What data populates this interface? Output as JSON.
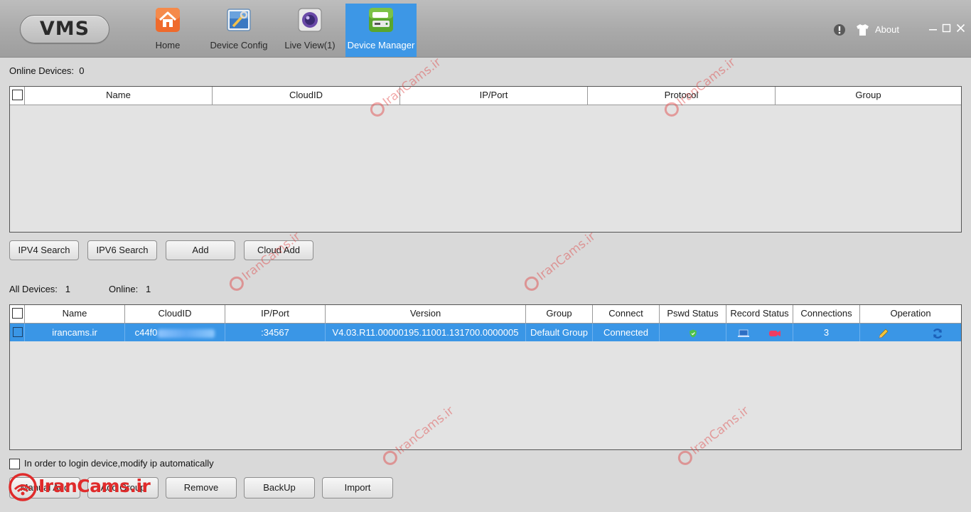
{
  "app": {
    "logo": "VMS"
  },
  "nav": {
    "tabs": [
      {
        "label": "Home",
        "icon": "home-icon"
      },
      {
        "label": "Device Config",
        "icon": "device-config-icon"
      },
      {
        "label": "Live View(1)",
        "icon": "live-view-icon"
      },
      {
        "label": "Device Manager",
        "icon": "device-manager-icon",
        "active": true
      }
    ],
    "about": "About"
  },
  "online_section": {
    "label": "Online Devices:",
    "count": "0",
    "columns": [
      "Name",
      "CloudID",
      "IP/Port",
      "Protocol",
      "Group"
    ]
  },
  "search_buttons": [
    "IPV4 Search",
    "IPV6 Search",
    "Add",
    "Cloud Add"
  ],
  "all_section": {
    "all_label": "All Devices:",
    "all_count": "1",
    "online_label": "Online:",
    "online_count": "1",
    "columns": [
      "Name",
      "CloudID",
      "IP/Port",
      "Version",
      "Group",
      "Connect",
      "Pswd Status",
      "Record Status",
      "Connections",
      "Operation"
    ],
    "rows": [
      {
        "name": "irancams.ir",
        "cloudid": "c44f0",
        "ipport": ":34567",
        "version": "V4.03.R11.00000195.11001.131700.0000005",
        "group": "Default Group",
        "connect": "Connected",
        "connections": "3"
      }
    ]
  },
  "auto_ip_label": "In order to login device,modify ip automatically",
  "bottom_buttons": [
    "Manual Add",
    "Add Group",
    "Remove",
    "BackUp",
    "Import"
  ],
  "watermark": "IranCams.ir",
  "brand": "IranCams.ir",
  "colors": {
    "accent": "#3a96e6",
    "watermark": "#e04040"
  }
}
